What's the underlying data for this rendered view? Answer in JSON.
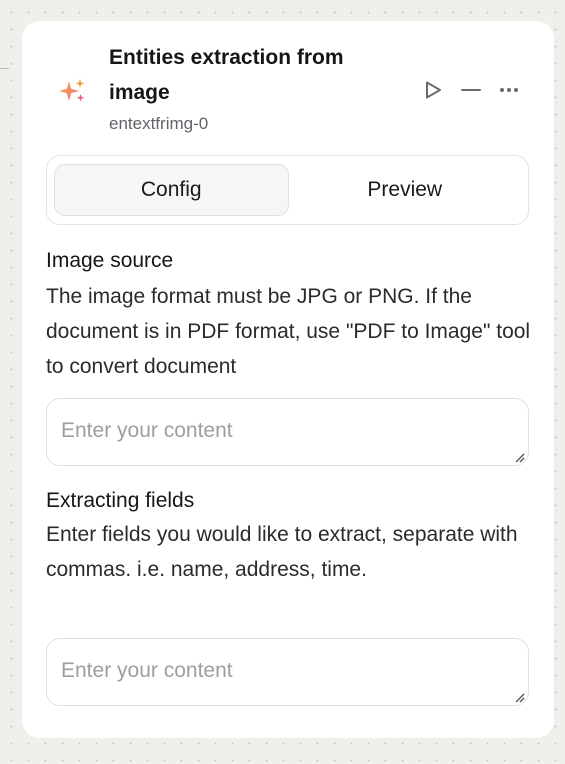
{
  "node": {
    "title": "Entities extraction from image",
    "subtitle": "entextfrimg-0",
    "icon": "sparkles-icon",
    "icon_colors": [
      "#f29d3d",
      "#e8618c"
    ],
    "actions": [
      {
        "name": "run",
        "icon": "play-icon"
      },
      {
        "name": "minimize",
        "icon": "minus-icon"
      },
      {
        "name": "more",
        "icon": "more-horizontal-icon"
      }
    ]
  },
  "tabs": [
    {
      "label": "Config",
      "active": true
    },
    {
      "label": "Preview",
      "active": false
    }
  ],
  "fields": [
    {
      "title": "Image source",
      "description": "The image format must be JPG or PNG. If the document is in PDF format, use \"PDF to Image\" tool to convert document",
      "value": "",
      "placeholder": "Enter your content"
    },
    {
      "title": "Extracting fields",
      "description": "Enter fields you would like to extract, separate with commas. i.e. name, address, time.",
      "value": "",
      "placeholder": "Enter your content"
    }
  ]
}
